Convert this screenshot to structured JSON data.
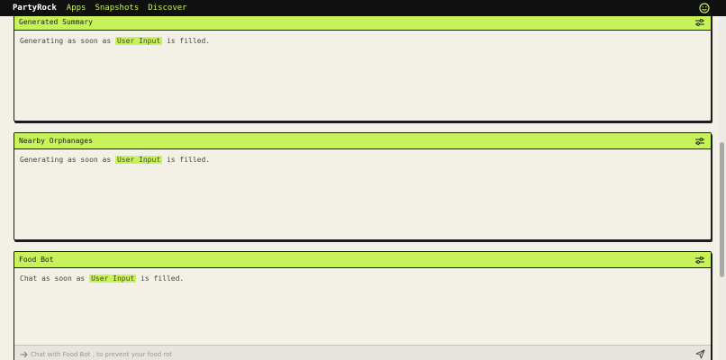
{
  "topbar": {
    "brand": "PartyRock",
    "nav": [
      {
        "label": "Apps"
      },
      {
        "label": "Snapshots"
      },
      {
        "label": "Discover"
      }
    ],
    "accent": "#c8f25a"
  },
  "widgets": [
    {
      "title": "Generated Summary",
      "pre": "Generating as soon as ",
      "tag": "User Input",
      "post": " is filled."
    },
    {
      "title": "Nearby Orphanages",
      "pre": "Generating as soon as ",
      "tag": "User Input",
      "post": " is filled."
    },
    {
      "title": "Food Bot",
      "pre": "Chat as soon as ",
      "tag": "User Input",
      "post": " is filled.",
      "chat_placeholder": "Chat with Food Bot , to prevent your food rot"
    }
  ],
  "icons": {
    "profile": "smiley-icon",
    "settings": "sliders-icon",
    "send": "send-icon",
    "chat_prefix": "arrow-right-icon"
  }
}
